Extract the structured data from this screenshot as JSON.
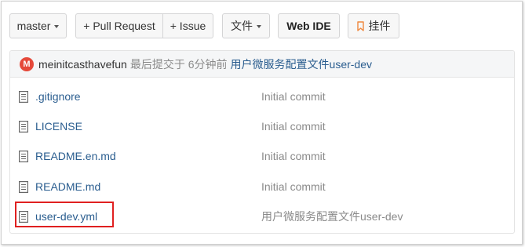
{
  "toolbar": {
    "branch_label": "master",
    "pull_request_label": "+ Pull Request",
    "issue_label": "+ Issue",
    "files_label": "文件",
    "webide_label": "Web IDE",
    "bookmark_label": "挂件"
  },
  "commit": {
    "avatar_letter": "M",
    "author": "meinitcasthavefun",
    "meta": "最后提交于 6分钟前",
    "message": "用户微服务配置文件user-dev"
  },
  "files": [
    {
      "name": ".gitignore",
      "commit": "Initial commit"
    },
    {
      "name": "LICENSE",
      "commit": "Initial commit"
    },
    {
      "name": "README.en.md",
      "commit": "Initial commit"
    },
    {
      "name": "README.md",
      "commit": "Initial commit"
    },
    {
      "name": "user-dev.yml",
      "commit": "用户微服务配置文件user-dev"
    }
  ],
  "colors": {
    "link": "#2a5d8f",
    "muted": "#8a8a8a",
    "avatar": "#e5493a",
    "highlight": "#e02020",
    "bookmark": "#f0883e"
  }
}
